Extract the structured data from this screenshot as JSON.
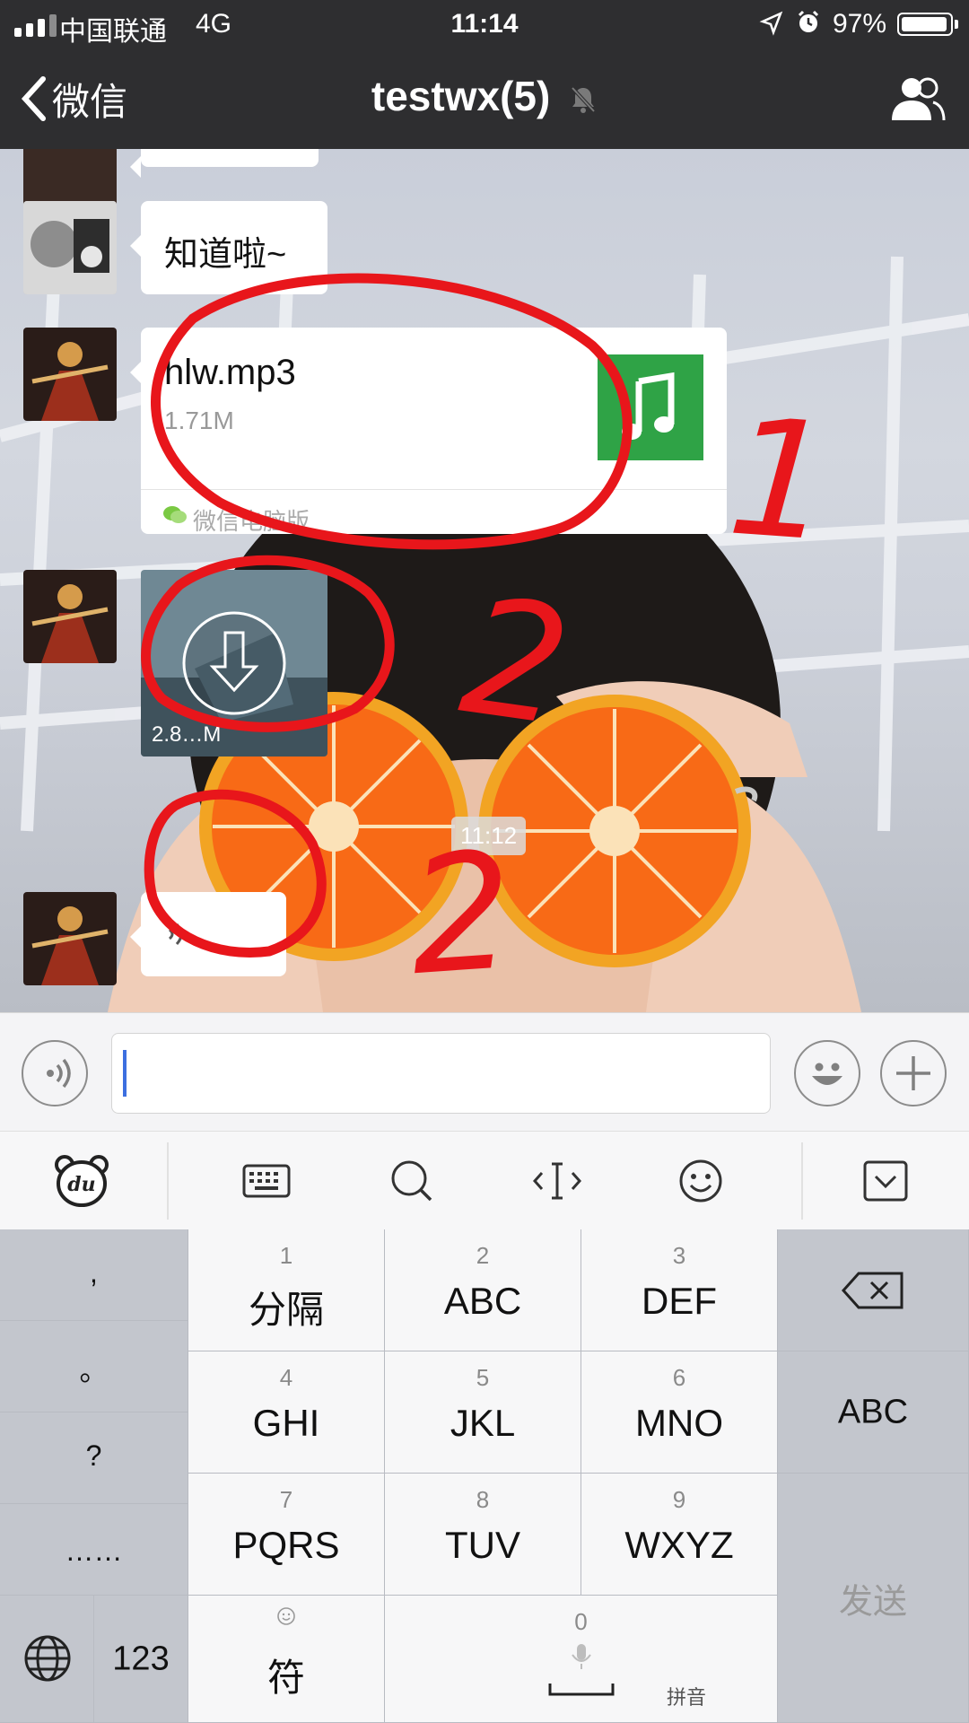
{
  "status_bar": {
    "carrier": "中国联通",
    "network": "4G",
    "time": "11:14",
    "battery_percent": "97%",
    "battery_level": 0.97
  },
  "nav": {
    "back_label": "微信",
    "title": "testwx(5)"
  },
  "messages": {
    "text_message": "知道啦~",
    "file": {
      "name": "hlw.mp3",
      "size": "1.71M",
      "source": "微信电脑版"
    },
    "video": {
      "size": "2.8…M"
    },
    "timestamp": "11:12"
  },
  "annotations": {
    "mark_1": "1",
    "mark_2": "2",
    "mark_3": "2"
  },
  "ime_toolbar": [
    "du-logo-icon",
    "keyboard-icon",
    "search-icon",
    "cursor-icon",
    "emoji-icon",
    "collapse-icon"
  ],
  "keyboard": {
    "punct": [
      ",",
      "。",
      "?",
      "……"
    ],
    "keys": [
      {
        "num": "1",
        "label": "分隔"
      },
      {
        "num": "2",
        "label": "ABC"
      },
      {
        "num": "3",
        "label": "DEF"
      },
      {
        "num": "4",
        "label": "GHI"
      },
      {
        "num": "5",
        "label": "JKL"
      },
      {
        "num": "6",
        "label": "MNO"
      },
      {
        "num": "7",
        "label": "PQRS"
      },
      {
        "num": "8",
        "label": "TUV"
      },
      {
        "num": "9",
        "label": "WXYZ"
      }
    ],
    "abc": "ABC",
    "send": "发送",
    "num_switch": "123",
    "symbol": "符",
    "space_num": "0",
    "space_label": "拼音"
  },
  "colors": {
    "nav_bg": "#2e2e30",
    "file_icon_green": "#2fa346",
    "annotation_red": "#e8161b",
    "caret_blue": "#3c6fe0"
  }
}
